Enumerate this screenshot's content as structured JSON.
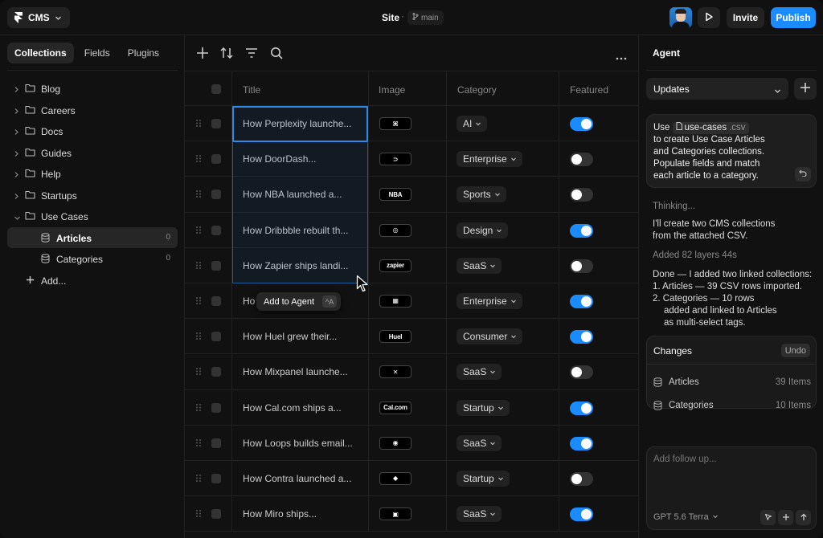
{
  "topbar": {
    "cms_label": "CMS",
    "site_title": "Site",
    "separator": "·",
    "branch": "main",
    "invite_label": "Invite",
    "publish_label": "Publish"
  },
  "sidebar": {
    "tabs": [
      "Collections",
      "Fields",
      "Plugins"
    ],
    "items": [
      {
        "label": "Blog"
      },
      {
        "label": "Careers"
      },
      {
        "label": "Docs"
      },
      {
        "label": "Guides"
      },
      {
        "label": "Help"
      },
      {
        "label": "Startups"
      },
      {
        "label": "Use Cases"
      }
    ],
    "children": [
      {
        "label": "Articles",
        "count": "0"
      },
      {
        "label": "Categories",
        "count": "0"
      }
    ],
    "add_label": "Add..."
  },
  "table": {
    "headers": {
      "title": "Title",
      "image": "Image",
      "category": "Category",
      "featured": "Featured"
    },
    "rows": [
      {
        "title": "How Perplexity launche...",
        "logo": "⌘",
        "category": "AI",
        "featured": true
      },
      {
        "title": "How DoorDash...",
        "logo": "⊃",
        "category": "Enterprise",
        "featured": false
      },
      {
        "title": "How NBA launched a...",
        "logo": "NBA",
        "category": "Sports",
        "featured": false
      },
      {
        "title": "How Dribbble rebuilt th...",
        "logo": "◎",
        "category": "Design",
        "featured": true
      },
      {
        "title": "How Zapier ships landi...",
        "logo": "zapier",
        "category": "SaaS",
        "featured": false
      },
      {
        "title": "Ho",
        "logo": "▦",
        "category": "Enterprise",
        "featured": true
      },
      {
        "title": "How Huel grew their...",
        "logo": "Huel",
        "category": "Consumer",
        "featured": true
      },
      {
        "title": "How Mixpanel launche...",
        "logo": "✕",
        "category": "SaaS",
        "featured": false
      },
      {
        "title": "How Cal.com ships a...",
        "logo": "Cal.com",
        "category": "Startup",
        "featured": true
      },
      {
        "title": "How Loops builds email...",
        "logo": "◉",
        "category": "SaaS",
        "featured": true
      },
      {
        "title": "How Contra launched a...",
        "logo": "◆",
        "category": "Startup",
        "featured": false
      },
      {
        "title": "How Miro ships...",
        "logo": "▣",
        "category": "SaaS",
        "featured": true
      }
    ],
    "tooltip": {
      "label": "Add to Agent",
      "shortcut": "^A"
    }
  },
  "agent": {
    "title": "Agent",
    "mode": "Updates",
    "message": {
      "prefix": "Use",
      "file_name": "use-cases",
      "file_ext": ".csv",
      "line1": "to create Use Case Articles",
      "line2": "and Categories collections.",
      "line3": "Populate fields and match",
      "line4": "each article to a category."
    },
    "thinking": "Thinking...",
    "reply_line1": "I'll create two CMS collections",
    "reply_line2": "from the attached CSV.",
    "meta": "Added 82 layers 44s",
    "done_line1": "Done — I added two linked collections:",
    "done_line2": "1.  Articles — 39 CSV rows imported.",
    "done_line3": "2.  Categories — 10 rows",
    "done_line4": "added and linked to Articles",
    "done_line5": "as multi-select tags.",
    "changes": {
      "title": "Changes",
      "undo": "Undo",
      "items": [
        {
          "name": "Articles",
          "count": "39 Items"
        },
        {
          "name": "Categories",
          "count": "10 Items"
        }
      ]
    },
    "compose_placeholder": "Add follow up...",
    "model": "GPT 5.6 Terra"
  },
  "colors": {
    "accent": "#1a8cff",
    "background": "#111111",
    "panel": "#1e1e1e"
  }
}
